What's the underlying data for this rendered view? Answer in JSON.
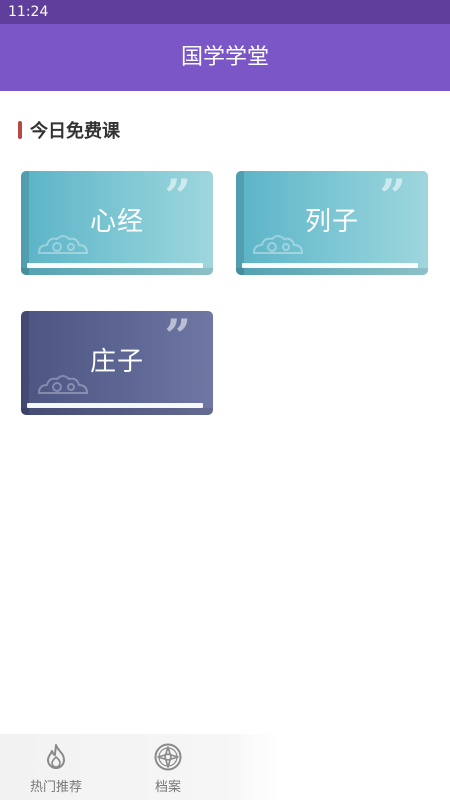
{
  "status_bar": {
    "time": "11:24"
  },
  "app_bar": {
    "title": "国学学堂"
  },
  "section": {
    "title": "今日免费课"
  },
  "courses": [
    {
      "title": "心经",
      "style": "teal"
    },
    {
      "title": "列子",
      "style": "teal"
    },
    {
      "title": "庄子",
      "style": "indigo"
    }
  ],
  "quote_mark": "”",
  "bottom_nav": {
    "items": [
      {
        "label": "热门推荐",
        "icon": "flame-icon"
      },
      {
        "label": "档案",
        "icon": "compass-icon"
      }
    ]
  },
  "colors": {
    "status_bar": "#5f3f9b",
    "app_bar": "#7a56c6",
    "section_accent": "#b64a43",
    "card_teal": "#7fc8d4",
    "card_indigo": "#5e6694"
  }
}
